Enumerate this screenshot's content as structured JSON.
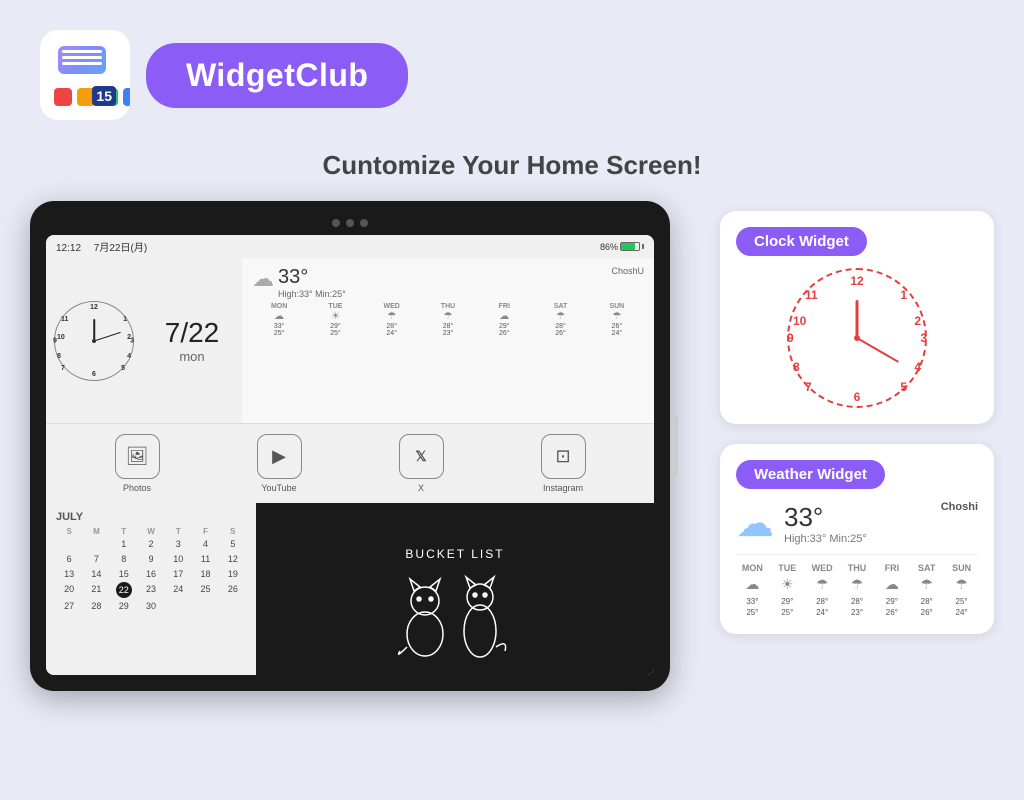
{
  "header": {
    "brand_name": "WidgetClub",
    "logo_number": "15"
  },
  "tagline": "Cuntomize Your Home Screen!",
  "tablet": {
    "status_left": "12:12 　7月22日(月)",
    "battery": "86%",
    "clock": {
      "hour_rotation": "0",
      "minute_rotation": "72"
    },
    "date": {
      "value": "7/22",
      "day": "mon"
    },
    "weather": {
      "temp": "33°",
      "high": "High:33°",
      "low": "Min:25°",
      "location": "ChoshU",
      "days": [
        {
          "label": "MON",
          "temp_hi": "33°",
          "temp_lo": "25°"
        },
        {
          "label": "TUE",
          "temp_hi": "29°",
          "temp_lo": "25°"
        },
        {
          "label": "WED",
          "temp_hi": "28°",
          "temp_lo": "24°"
        },
        {
          "label": "THU",
          "temp_hi": "28°",
          "temp_lo": "23°"
        },
        {
          "label": "FRI",
          "temp_hi": "29°",
          "temp_lo": "26°"
        },
        {
          "label": "SAT",
          "temp_hi": "28°",
          "temp_lo": "26°"
        },
        {
          "label": "SUN",
          "temp_hi": "26°",
          "temp_lo": "24°"
        }
      ]
    },
    "apps": [
      {
        "label": "Photos",
        "icon": "🖼"
      },
      {
        "label": "YouTube",
        "icon": "▶"
      },
      {
        "label": "X",
        "icon": "𝕏"
      },
      {
        "label": "Instagram",
        "icon": "⊡"
      }
    ],
    "calendar": {
      "month": "JULY",
      "headers": [
        "S",
        "M",
        "T",
        "W",
        "T",
        "F",
        "S"
      ],
      "today": "22",
      "days": [
        [
          "",
          "",
          "1",
          "2",
          "3",
          "4",
          "5"
        ],
        [
          "6",
          "7",
          "8",
          "9",
          "10",
          "11",
          "12"
        ],
        [
          "13",
          "14",
          "15",
          "16",
          "17",
          "18",
          "19"
        ],
        [
          "20",
          "21",
          "22",
          "23",
          "24",
          "25",
          "26"
        ],
        [
          "27",
          "28",
          "29",
          "30",
          "",
          "",
          ""
        ]
      ]
    },
    "bucket_list": {
      "title": "Bucket List"
    }
  },
  "clock_widget": {
    "label": "Clock Widget",
    "hour_rotation": "0",
    "minute_rotation": "120",
    "numbers": [
      "12",
      "1",
      "2",
      "3",
      "4",
      "5",
      "6",
      "7",
      "8",
      "9",
      "10",
      "11"
    ]
  },
  "weather_widget": {
    "label": "Weather Widget",
    "temp": "33°",
    "high": "High:33°",
    "min": "Min:25°",
    "location": "Choshi",
    "forecast": [
      {
        "day": "MON",
        "icon": "☁",
        "hi": "33°",
        "lo": "25°"
      },
      {
        "day": "TUE",
        "icon": "☀",
        "hi": "29°",
        "lo": "25°"
      },
      {
        "day": "WED",
        "icon": "☂",
        "hi": "28°",
        "lo": "24°"
      },
      {
        "day": "THU",
        "icon": "☂",
        "hi": "28°",
        "lo": "23°"
      },
      {
        "day": "FRI",
        "icon": "☁",
        "hi": "29°",
        "lo": "26°"
      },
      {
        "day": "SAT",
        "icon": "☂",
        "hi": "28°",
        "lo": "26°"
      },
      {
        "day": "SUN",
        "icon": "☂",
        "hi": "25°",
        "lo": "24°"
      }
    ]
  },
  "colors": {
    "brand_purple": "#8b5cf6",
    "background": "#e8eaf6",
    "clock_red": "#e53e3e"
  }
}
